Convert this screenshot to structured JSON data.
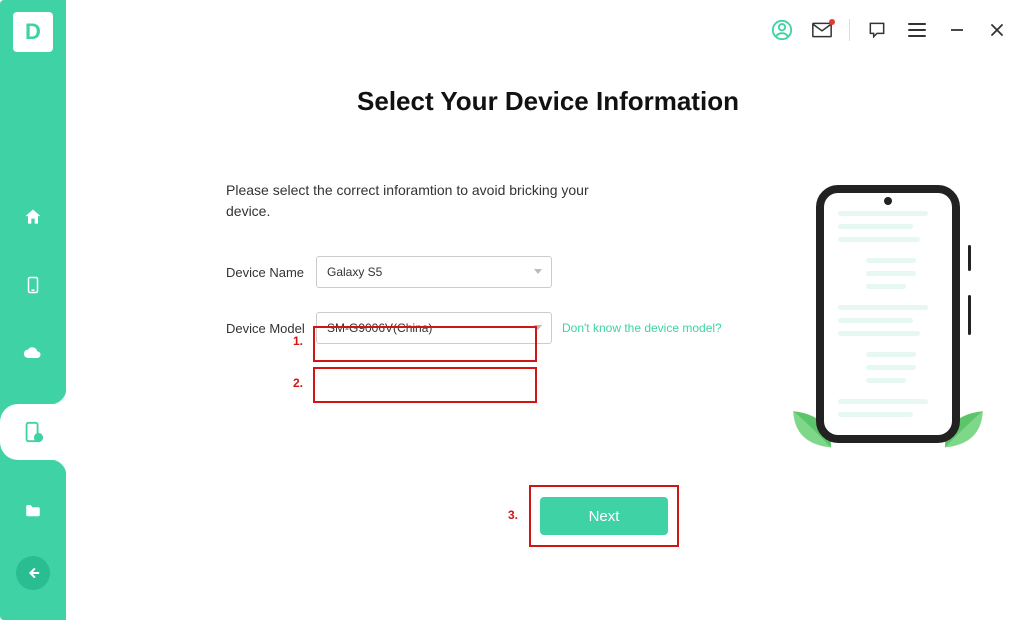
{
  "app": {
    "logo_letter": "D"
  },
  "title": "Select Your Device Information",
  "hint": "Please select the correct inforamtion to avoid bricking your device.",
  "form": {
    "device_name_label": "Device Name",
    "device_name_value": "Galaxy S5",
    "device_model_label": "Device Model",
    "device_model_value": "SM-G9006V(China)",
    "help_link": "Don't know the device model?",
    "next_button": "Next"
  },
  "annotations": {
    "n1": "1.",
    "n2": "2.",
    "n3": "3."
  },
  "colors": {
    "accent": "#3fd2a5",
    "annotate": "#d01515"
  }
}
